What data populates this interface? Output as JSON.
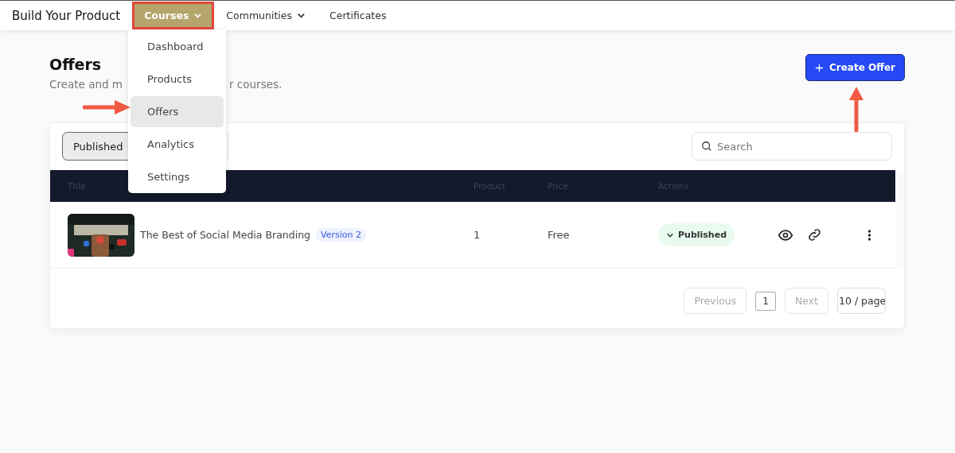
{
  "nav": {
    "brand": "Build Your Product",
    "items": [
      {
        "label": "Courses",
        "selected": true,
        "has_menu": true
      },
      {
        "label": "Communities",
        "selected": false,
        "has_menu": true
      },
      {
        "label": "Certificates",
        "selected": false,
        "has_menu": false
      }
    ]
  },
  "menu": {
    "items": [
      {
        "label": "Dashboard",
        "selected": false
      },
      {
        "label": "Products",
        "selected": false
      },
      {
        "label": "Offers",
        "selected": true
      },
      {
        "label": "Analytics",
        "selected": false
      },
      {
        "label": "Settings",
        "selected": false
      }
    ]
  },
  "page": {
    "title": "Offers",
    "subtitle_parts": [
      "Create and m",
      "r courses."
    ],
    "create_button": "Create Offer"
  },
  "filters": [
    {
      "label": "Published",
      "selected": true
    }
  ],
  "search": {
    "placeholder": "Search"
  },
  "table": {
    "columns": [
      "Title",
      "Product",
      "Price",
      "Actions"
    ],
    "rows": [
      {
        "title": "The Best of Social Media Branding",
        "version": "Version 2",
        "product": "1",
        "price": "Free",
        "status": "Published"
      }
    ]
  },
  "pagination": {
    "previous": {
      "label": "Previous",
      "disabled": true
    },
    "pages": [
      {
        "label": "1",
        "selected": true
      }
    ],
    "next": {
      "label": "Next",
      "disabled": true
    },
    "page_size": "10 / page"
  }
}
